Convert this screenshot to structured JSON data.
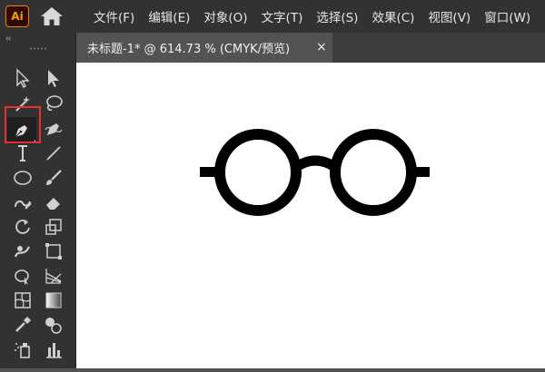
{
  "app": {
    "logo_text": "Ai"
  },
  "menu": {
    "items": [
      "文件(F)",
      "编辑(E)",
      "对象(O)",
      "文字(T)",
      "选择(S)",
      "效果(C)",
      "视图(V)",
      "窗口(W)"
    ]
  },
  "toolbar": {
    "collapse_label": "‹‹",
    "active_tool": "pen-tool",
    "tools": [
      "selection-tool",
      "direct-selection-tool",
      "magic-wand-tool",
      "lasso-tool",
      "pen-tool",
      "curvature-tool",
      "type-tool",
      "line-segment-tool",
      "ellipse-tool",
      "paintbrush-tool",
      "shaper-tool",
      "eraser-tool",
      "rotate-tool",
      "scale-tool",
      "warp-tool",
      "free-transform-tool",
      "shape-builder-tool",
      "perspective-grid-tool",
      "mesh-tool",
      "gradient-tool",
      "eyedropper-tool",
      "blend-tool",
      "symbol-sprayer-tool",
      "column-graph-tool"
    ],
    "highlight_color": "#e8302e"
  },
  "document": {
    "tab_title": "未标题-1* @ 614.73 % (CMYK/预览)",
    "close_label": "×"
  },
  "artwork": {
    "subject": "glasses-icon",
    "stroke_color": "#000000"
  }
}
